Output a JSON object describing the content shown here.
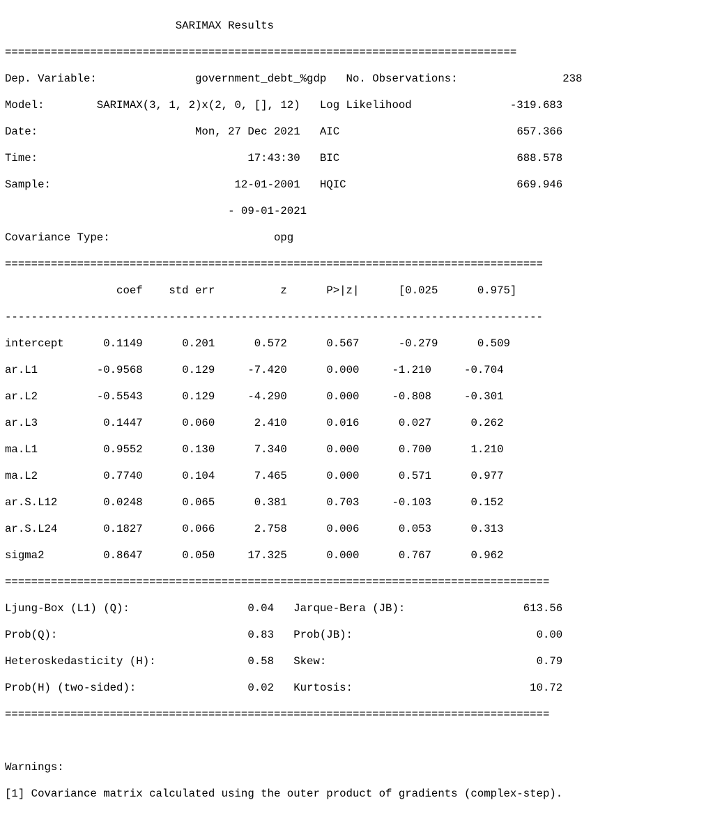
{
  "title": "SARIMAX Results",
  "header": {
    "left": [
      {
        "label": "Dep. Variable:",
        "value": "government_debt_%gdp"
      },
      {
        "label": "Model:",
        "value": "SARIMAX(3, 1, 2)x(2, 0, [], 12)"
      },
      {
        "label": "Date:",
        "value": "Mon, 27 Dec 2021"
      },
      {
        "label": "Time:",
        "value": "17:43:30"
      },
      {
        "label": "Sample:",
        "value": "12-01-2001"
      },
      {
        "label": "",
        "value": "- 09-01-2021"
      },
      {
        "label": "Covariance Type:",
        "value": "opg"
      }
    ],
    "right": [
      {
        "label": "No. Observations:",
        "value": "238"
      },
      {
        "label": "Log Likelihood",
        "value": "-319.683"
      },
      {
        "label": "AIC",
        "value": "657.366"
      },
      {
        "label": "BIC",
        "value": "688.578"
      },
      {
        "label": "HQIC",
        "value": "669.946"
      }
    ]
  },
  "coef_table": {
    "headers": [
      "",
      "coef",
      "std err",
      "z",
      "P>|z|",
      "[0.025",
      "0.975]"
    ],
    "rows": [
      [
        "intercept",
        "0.1149",
        "0.201",
        "0.572",
        "0.567",
        "-0.279",
        "0.509"
      ],
      [
        "ar.L1",
        "-0.9568",
        "0.129",
        "-7.420",
        "0.000",
        "-1.210",
        "-0.704"
      ],
      [
        "ar.L2",
        "-0.5543",
        "0.129",
        "-4.290",
        "0.000",
        "-0.808",
        "-0.301"
      ],
      [
        "ar.L3",
        "0.1447",
        "0.060",
        "2.410",
        "0.016",
        "0.027",
        "0.262"
      ],
      [
        "ma.L1",
        "0.9552",
        "0.130",
        "7.340",
        "0.000",
        "0.700",
        "1.210"
      ],
      [
        "ma.L2",
        "0.7740",
        "0.104",
        "7.465",
        "0.000",
        "0.571",
        "0.977"
      ],
      [
        "ar.S.L12",
        "0.0248",
        "0.065",
        "0.381",
        "0.703",
        "-0.103",
        "0.152"
      ],
      [
        "ar.S.L24",
        "0.1827",
        "0.066",
        "2.758",
        "0.006",
        "0.053",
        "0.313"
      ],
      [
        "sigma2",
        "0.8647",
        "0.050",
        "17.325",
        "0.000",
        "0.767",
        "0.962"
      ]
    ]
  },
  "diagnostics": [
    {
      "label": "Ljung-Box (L1) (Q):",
      "value": "0.04",
      "label2": "Jarque-Bera (JB):",
      "value2": "613.56"
    },
    {
      "label": "Prob(Q):",
      "value": "0.83",
      "label2": "Prob(JB):",
      "value2": "0.00"
    },
    {
      "label": "Heteroskedasticity (H):",
      "value": "0.58",
      "label2": "Skew:",
      "value2": "0.79"
    },
    {
      "label": "Prob(H) (two-sided):",
      "value": "0.02",
      "label2": "Kurtosis:",
      "value2": "10.72"
    }
  ],
  "warnings": {
    "heading": "Warnings:",
    "items": [
      "[1] Covariance matrix calculated using the outer product of gradients (complex-step)."
    ]
  }
}
